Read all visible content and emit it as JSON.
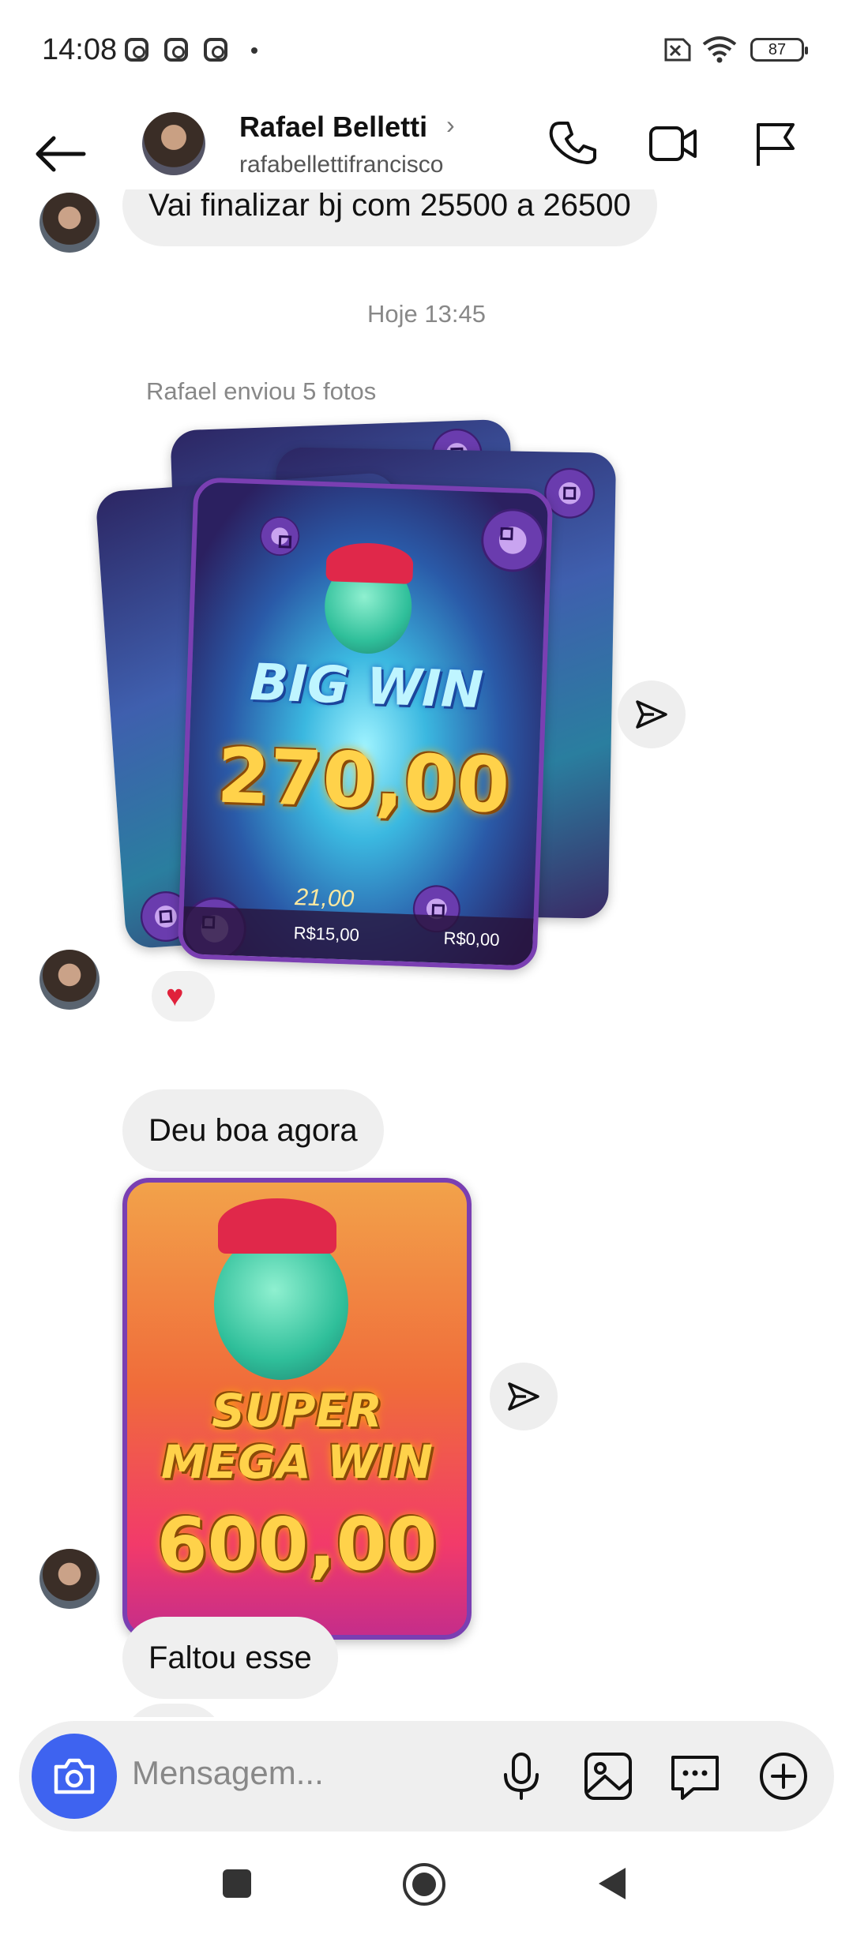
{
  "status_bar": {
    "time": "14:08",
    "battery": "87"
  },
  "header": {
    "contact_name": "Rafael Belletti",
    "username": "rafabellettifrancisco"
  },
  "messages": {
    "partial_top": "Vai finalizar bj com 25500 a 26500",
    "timestamp": "Hoje 13:45",
    "photos_note": "Rafael enviou 5 fotos",
    "photo_stack": {
      "banner": "BIG WIN",
      "amount": "270,00",
      "bet_label": "R$15,00",
      "balance_label": "R$0,00",
      "total_win": "21,00"
    },
    "reaction": "heart",
    "text_1": "Deu boa agora",
    "photo_single": {
      "banner_line1": "SUPER",
      "banner_line2": "MEGA WIN",
      "amount": "600,00"
    },
    "text_2": "Faltou esse"
  },
  "composer": {
    "placeholder": "Mensagem..."
  },
  "colors": {
    "accent": "#3e63f0",
    "bubble": "#efefef",
    "heart": "#e0213b"
  },
  "icons": [
    "back-arrow-icon",
    "phone-icon",
    "video-icon",
    "flag-icon",
    "share-icon",
    "camera-icon",
    "microphone-icon",
    "gallery-icon",
    "sticker-icon",
    "plus-icon",
    "nav-recents-icon",
    "nav-home-icon",
    "nav-back-icon"
  ]
}
